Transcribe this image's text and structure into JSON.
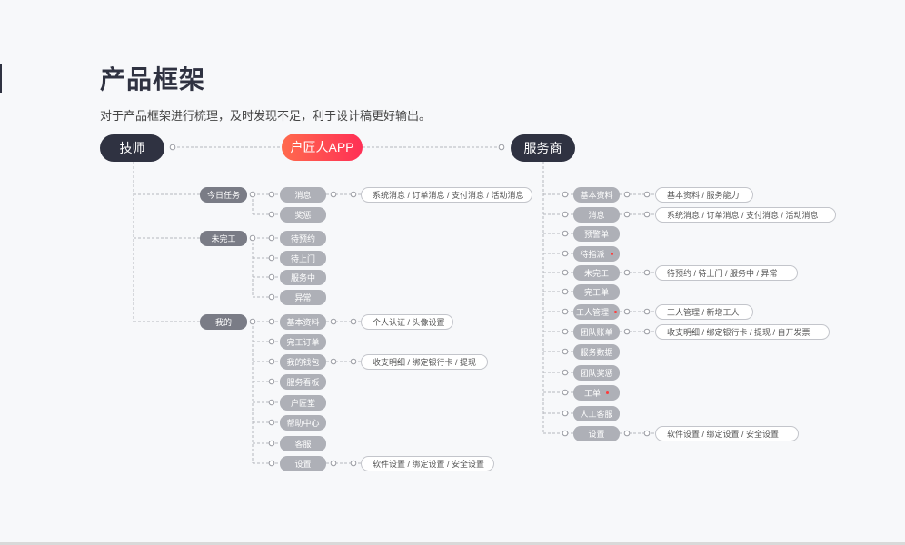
{
  "page": {
    "title": "产品框架",
    "subtitle": "对于产品框架进行梳理，及时发现不足，利于设计稿更好输出。"
  },
  "roots": {
    "left": "技师",
    "center": "户匠人APP",
    "right": "服务商"
  },
  "technician": {
    "categories": [
      {
        "label": "今日任务",
        "items": [
          {
            "label": "消息",
            "detail": "系统消息 / 订单消息 / 支付消息 / 活动消息"
          },
          {
            "label": "奖惩"
          }
        ]
      },
      {
        "label": "未完工",
        "items": [
          {
            "label": "待预约"
          },
          {
            "label": "待上门"
          },
          {
            "label": "服务中"
          },
          {
            "label": "异常"
          }
        ]
      },
      {
        "label": "我的",
        "items": [
          {
            "label": "基本资料",
            "detail": "个人认证 / 头像设置"
          },
          {
            "label": "完工订单"
          },
          {
            "label": "我的钱包",
            "detail": "收支明细 / 绑定银行卡 / 提现"
          },
          {
            "label": "服务看板"
          },
          {
            "label": "户匠堂"
          },
          {
            "label": "帮助中心"
          },
          {
            "label": "客服"
          },
          {
            "label": "设置",
            "detail": "软件设置 / 绑定设置 / 安全设置"
          }
        ]
      }
    ]
  },
  "provider": {
    "items": [
      {
        "label": "基本资料",
        "detail": "基本资料 / 服务能力"
      },
      {
        "label": "消息",
        "detail": "系统消息 / 订单消息 / 支付消息 / 活动消息"
      },
      {
        "label": "预警单"
      },
      {
        "label": "待指派",
        "marked": true
      },
      {
        "label": "未完工",
        "detail": "待预约 / 待上门 / 服务中 / 异常"
      },
      {
        "label": "完工单"
      },
      {
        "label": "工人管理",
        "marked": true,
        "detail": "工人管理 / 新增工人"
      },
      {
        "label": "团队账单",
        "detail": "收支明细 / 绑定银行卡 / 提现 / 自开发票"
      },
      {
        "label": "服务数据"
      },
      {
        "label": "团队奖惩"
      },
      {
        "label": "工单",
        "marked": true
      },
      {
        "label": "人工客服"
      },
      {
        "label": "设置",
        "detail": "软件设置 / 绑定设置 / 安全设置"
      }
    ]
  },
  "colors": {
    "dark_node": "#2f3241",
    "brand_gradient_start": "#ff6a4d",
    "brand_gradient_end": "#ff2f55",
    "category_node": "#7a7c86",
    "item_node": "#aeb0b7",
    "connector": "#b5b7bd",
    "marker": "#ff3b3b"
  }
}
